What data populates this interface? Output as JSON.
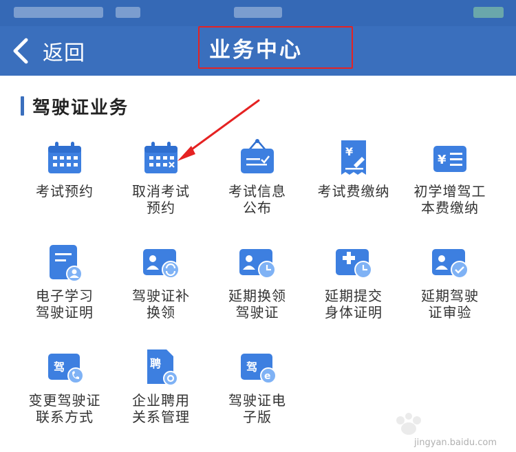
{
  "header": {
    "back_label": "返回",
    "title": "业务中心"
  },
  "section": {
    "title": "驾驶证业务"
  },
  "items": [
    {
      "label_line1": "考试预约",
      "label_line2": "",
      "icon": "calendar-icon"
    },
    {
      "label_line1": "取消考试",
      "label_line2": "预约",
      "icon": "calendar-cancel-icon"
    },
    {
      "label_line1": "考试信息",
      "label_line2": "公布",
      "icon": "notice-board-icon"
    },
    {
      "label_line1": "考试费缴纳",
      "label_line2": "",
      "icon": "receipt-yuan-icon"
    },
    {
      "label_line1": "初学增驾工",
      "label_line2": "本费缴纳",
      "icon": "card-yuan-icon"
    },
    {
      "label_line1": "电子学习",
      "label_line2": "驾驶证明",
      "icon": "document-user-icon"
    },
    {
      "label_line1": "驾驶证补",
      "label_line2": "换领",
      "icon": "id-card-refresh-icon"
    },
    {
      "label_line1": "延期换领",
      "label_line2": "驾驶证",
      "icon": "id-card-clock-icon"
    },
    {
      "label_line1": "延期提交",
      "label_line2": "身体证明",
      "icon": "medical-clock-icon"
    },
    {
      "label_line1": "延期驾驶",
      "label_line2": "证审验",
      "icon": "id-card-check-icon"
    },
    {
      "label_line1": "变更驾驶证",
      "label_line2": "联系方式",
      "icon": "card-phone-icon",
      "badge": "驾"
    },
    {
      "label_line1": "企业聘用",
      "label_line2": "关系管理",
      "icon": "document-gear-icon",
      "badge": "聘"
    },
    {
      "label_line1": "驾驶证电",
      "label_line2": "子版",
      "icon": "card-e-icon",
      "badge": "驾",
      "badge_e": "e"
    }
  ],
  "colors": {
    "navbar": "#3a6fbd",
    "icon_blue": "#3d7fe0",
    "icon_light": "#7fb2f5",
    "highlight": "#e52222"
  },
  "watermark": {
    "text": "jingyan.baidu.com"
  }
}
